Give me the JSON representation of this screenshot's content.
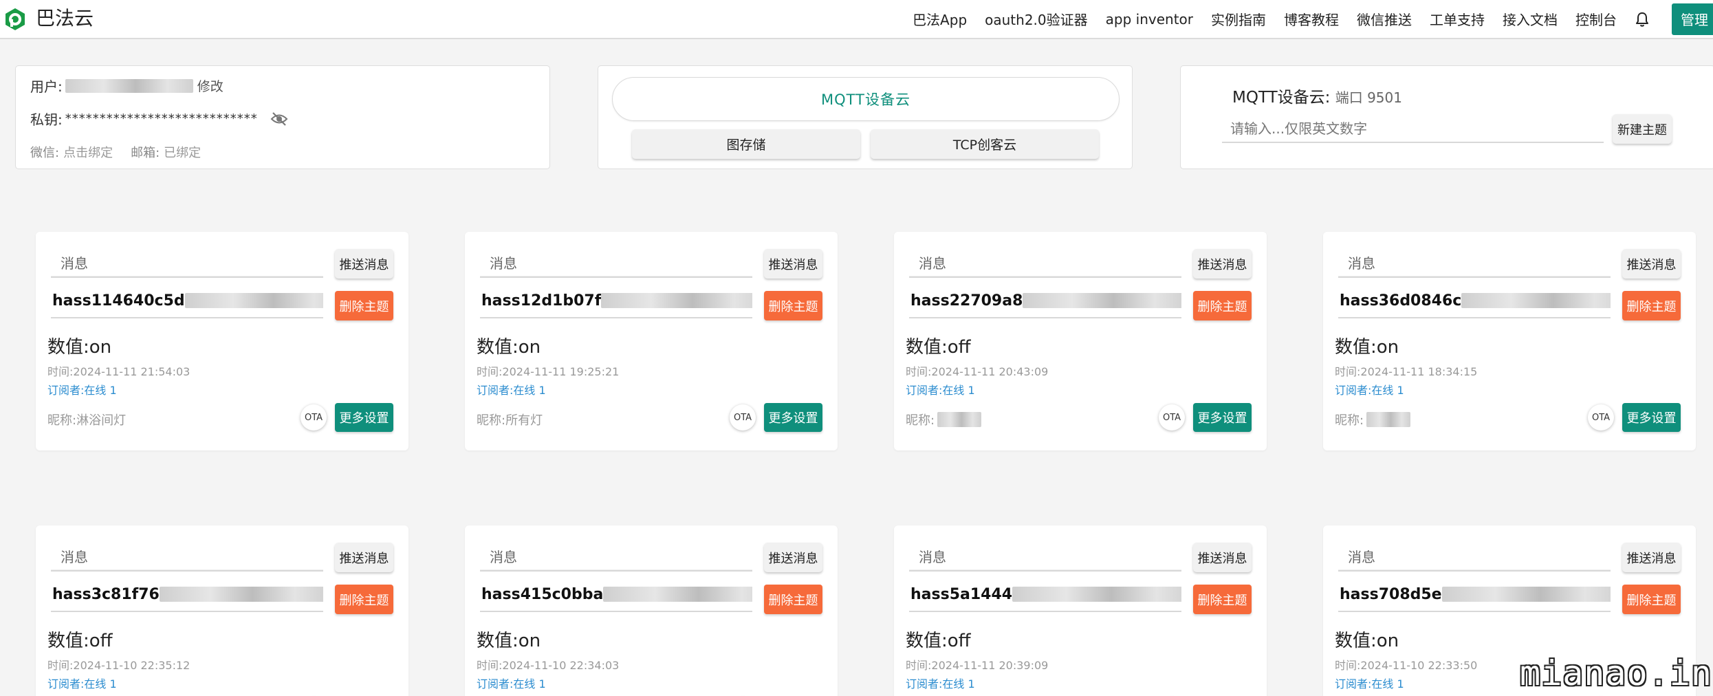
{
  "brand": {
    "name": "巴法云",
    "logo_icon": "bafa-logo-icon",
    "color": "#1a9b46"
  },
  "nav": {
    "items": [
      "巴法App",
      "oauth2.0验证器",
      "app inventor",
      "实例指南",
      "博客教程",
      "微信推送",
      "工单支持",
      "接入文档",
      "控制台"
    ],
    "bell_icon": "bell-icon",
    "manage_label": "管理"
  },
  "account": {
    "user_label": "用户:",
    "edit_label": "修改",
    "key_label": "私钥:",
    "key_masked": "****************************",
    "eye_icon": "eye-slash-icon",
    "wechat_label": "微信:",
    "wechat_value": "点击绑定",
    "email_label": "邮箱:",
    "email_value": "已绑定"
  },
  "service": {
    "mqtt_label": "MQTT设备云",
    "storage_label": "图存储",
    "tcp_label": "TCP创客云"
  },
  "topic_create": {
    "title": "MQTT设备云:",
    "port": "端口 9501",
    "placeholder": "请输入...仅限英文数字",
    "new_label": "新建主题"
  },
  "card_labels": {
    "msg_placeholder": "消息",
    "push": "推送消息",
    "delete": "删除主题",
    "value_prefix": "数值:",
    "time_prefix": "时间:",
    "sub_prefix": "订阅者:",
    "nick_prefix": "昵称:",
    "ota": "OTA",
    "more": "更多设置"
  },
  "devices": [
    {
      "topic_start": "hass114640c5d",
      "topic_end": "e",
      "value": "on",
      "time": "2024-11-11 21:54:03",
      "subscribers": "在线 1",
      "nickname": "淋浴间灯"
    },
    {
      "topic_start": "hass12d1b07f",
      "topic_end": "f",
      "value": "on",
      "time": "2024-11-11 19:25:21",
      "subscribers": "在线 1",
      "nickname": "所有灯"
    },
    {
      "topic_start": "hass22709a8",
      "topic_end": "8b",
      "value": "off",
      "time": "2024-11-11 20:43:09",
      "subscribers": "在线 1",
      "nickname": ""
    },
    {
      "topic_start": "hass36d0846c",
      "topic_end": "0",
      "value": "on",
      "time": "2024-11-11 18:34:15",
      "subscribers": "在线 1",
      "nickname": ""
    },
    {
      "topic_start": "hass3c81f76",
      "topic_end": "be",
      "value": "off",
      "time": "2024-11-10 22:35:12",
      "subscribers": "在线 1",
      "nickname": ""
    },
    {
      "topic_start": "hass415c0bba",
      "topic_end": "",
      "value": "on",
      "time": "2024-11-10 22:34:03",
      "subscribers": "在线 1",
      "nickname": ""
    },
    {
      "topic_start": "hass5a1444",
      "topic_end": "",
      "value": "off",
      "time": "2024-11-11 20:39:09",
      "subscribers": "在线 1",
      "nickname": ""
    },
    {
      "topic_start": "hass708d5e",
      "topic_end": "s",
      "value": "on",
      "time": "2024-11-10 22:33:50",
      "subscribers": "在线 1",
      "nickname": ""
    }
  ],
  "colors": {
    "primary": "#0f8f7c",
    "danger": "#f66a3a",
    "link": "#2b8ccf"
  },
  "watermark": "mianao.info"
}
